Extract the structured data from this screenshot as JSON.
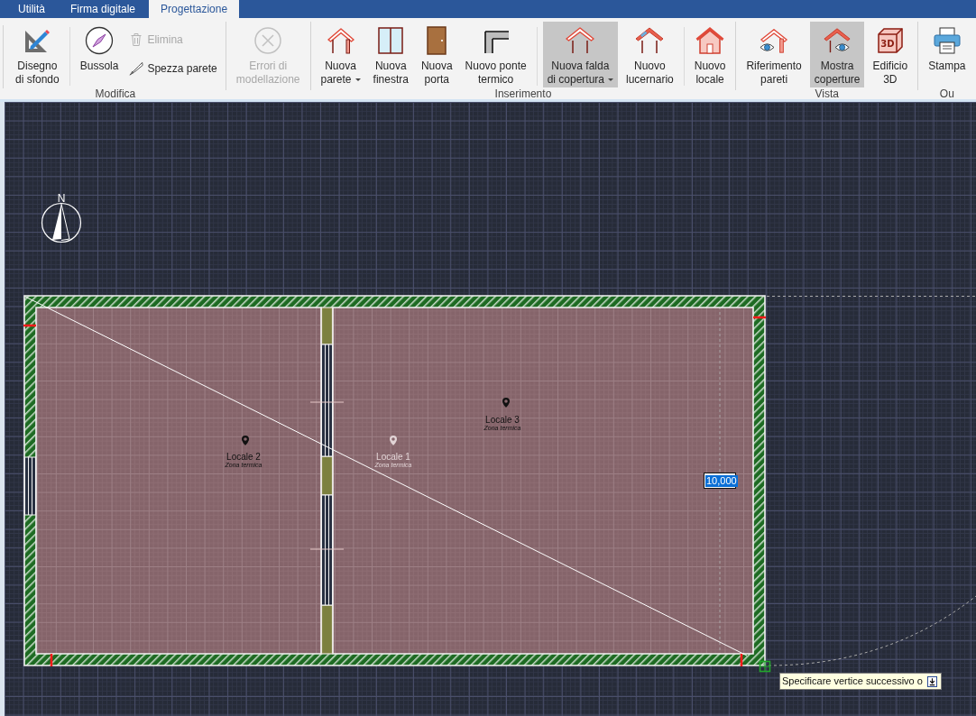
{
  "tabs": [
    {
      "label": "Utilità",
      "selected": false
    },
    {
      "label": "Firma digitale",
      "selected": false
    },
    {
      "label": "Progettazione",
      "selected": true
    }
  ],
  "ribbon": {
    "groups": [
      {
        "label": "Modifica",
        "sections": [
          {
            "buttons": [
              {
                "kind": "large",
                "label": "Disegno\ndi sfondo",
                "disabled": false,
                "pressed": false,
                "dropdown": false
              }
            ]
          },
          {
            "buttons": [
              {
                "kind": "large",
                "label": "Bussola",
                "disabled": false,
                "pressed": false,
                "dropdown": false
              },
              {
                "kind": "small",
                "label": "Elimina",
                "disabled": true,
                "pressed": false,
                "dropdown": false
              },
              {
                "kind": "small",
                "label": "Spezza parete",
                "disabled": false,
                "pressed": false,
                "dropdown": false
              }
            ]
          }
        ]
      },
      {
        "sections": [
          {
            "buttons": [
              {
                "kind": "large",
                "label": "Errori di\nmodellazione",
                "disabled": true,
                "pressed": false,
                "dropdown": false
              }
            ]
          }
        ]
      },
      {
        "label": "Inserimento",
        "sections": [
          {
            "buttons": [
              {
                "kind": "large",
                "label": "Nuova\nparete",
                "disabled": false,
                "pressed": false,
                "dropdown": true
              },
              {
                "kind": "large",
                "label": "Nuova\nfinestra",
                "disabled": false,
                "pressed": false,
                "dropdown": false
              },
              {
                "kind": "large",
                "label": "Nuova\nporta",
                "disabled": false,
                "pressed": false,
                "dropdown": false
              },
              {
                "kind": "large",
                "label": "Nuovo ponte\ntermico",
                "disabled": false,
                "pressed": false,
                "dropdown": false
              }
            ]
          },
          {
            "buttons": [
              {
                "kind": "large",
                "label": "Nuova falda\ndi copertura",
                "disabled": false,
                "pressed": true,
                "dropdown": true
              },
              {
                "kind": "large",
                "label": "Nuovo\nlucernario",
                "disabled": false,
                "pressed": false,
                "dropdown": false
              }
            ]
          },
          {
            "buttons": [
              {
                "kind": "large",
                "label": "Nuovo\nlocale",
                "disabled": false,
                "pressed": false,
                "dropdown": false
              }
            ]
          }
        ]
      },
      {
        "label": "Vista",
        "sections": [
          {
            "buttons": [
              {
                "kind": "large",
                "label": "Riferimento\npareti",
                "disabled": false,
                "pressed": false,
                "dropdown": false
              },
              {
                "kind": "large",
                "label": "Mostra\ncoperture",
                "disabled": false,
                "pressed": true,
                "dropdown": false
              },
              {
                "kind": "large",
                "label": "Edificio\n3D",
                "icon_text": "3D",
                "disabled": false,
                "pressed": false,
                "dropdown": false
              }
            ]
          }
        ]
      },
      {
        "label": "Ou",
        "sections": [
          {
            "buttons": [
              {
                "kind": "large",
                "label": "Stampa",
                "disabled": false,
                "pressed": false,
                "dropdown": false
              }
            ]
          }
        ]
      }
    ]
  },
  "canvas": {
    "compass": {
      "label": "N"
    },
    "rooms": [
      {
        "name": "Locale 2",
        "zone": "Zona termica",
        "faded": false
      },
      {
        "name": "Locale 1",
        "zone": "Zona termica",
        "faded": true
      },
      {
        "name": "Locale 3",
        "zone": "Zona termica",
        "faded": false
      }
    ],
    "length_input": {
      "value": "10,000"
    },
    "tooltip": {
      "text": "Specificare vertice successivo o"
    }
  }
}
